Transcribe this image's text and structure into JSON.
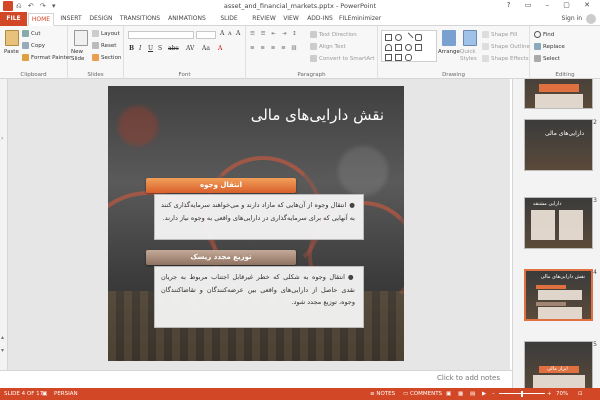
{
  "window": {
    "title": "asset_and_financial_markets.pptx - PowerPoint",
    "controls": "? ▭ – ▢ ✕",
    "qat": "⎌ ↶ ↷ ▾"
  },
  "tabs": [
    "FILE",
    "HOME",
    "INSERT",
    "DESIGN",
    "TRANSITIONS",
    "ANIMATIONS",
    "SLIDE SHOW",
    "REVIEW",
    "VIEW",
    "ADD-INS",
    "FILEminimizer"
  ],
  "active_tab": "HOME",
  "account": {
    "sign_in": "Sign in"
  },
  "ribbon": {
    "clipboard": {
      "label": "Clipboard",
      "paste": "Paste",
      "cut": "Cut",
      "copy": "Copy",
      "format_painter": "Format Painter"
    },
    "slides": {
      "label": "Slides",
      "new_slide": "New Slide",
      "layout": "Layout",
      "reset": "Reset",
      "section": "Section"
    },
    "font": {
      "label": "Font"
    },
    "paragraph": {
      "label": "Paragraph",
      "text_direction": "Text Direction",
      "align_text": "Align Text",
      "convert_smartart": "Convert to SmartArt"
    },
    "drawing": {
      "label": "Drawing",
      "arrange": "Arrange",
      "quick_styles": "Quick Styles",
      "shape_fill": "Shape Fill",
      "shape_outline": "Shape Outline",
      "shape_effects": "Shape Effects"
    },
    "editing": {
      "label": "Editing",
      "find": "Find",
      "replace": "Replace",
      "select": "Select"
    }
  },
  "slide": {
    "title": "نقش دارایی‌های مالی",
    "section1": {
      "heading": "انتقال وجوه",
      "text": "انتقال وجوه از آن‌هایی که مازاد دارند و می‌خواهند سرمایه‌گذاری کنند به آنهایی که برای سرمایه‌گذاری در دارایی‌های واقعی به وجوه نیاز دارند."
    },
    "section2": {
      "heading": "توزیع مجدد ریسک",
      "text": "انتقال وجوه به شکلی که خطر غیرقابل اجتناب مربوط به جریان نقدی حاصل از دارایی‌های واقعی بین عرضه‌کنندگان و تقاضاکنندگان وجوه، توزیع مجدد شود."
    }
  },
  "thumbnails": [
    {
      "num": "",
      "title": "",
      "selected": false
    },
    {
      "num": "2",
      "title": "دارایی‌های مالی",
      "selected": false
    },
    {
      "num": "3",
      "title": "دارایی مشتقه",
      "selected": false
    },
    {
      "num": "4",
      "title": "نقش دارایی‌های مالی",
      "selected": true
    },
    {
      "num": "5",
      "title": "ابزار مالی",
      "selected": false
    }
  ],
  "notes": {
    "placeholder": "Click to add notes"
  },
  "status": {
    "slide": "SLIDE 4 OF 17",
    "language": "PERSIAN",
    "notes": "NOTES",
    "comments": "COMMENTS",
    "zoom": "70%",
    "zoom_fraction": 0.5
  },
  "colors": {
    "accent": "#d24726",
    "banner_orange": "#e07040",
    "banner_brown": "#a08575"
  }
}
